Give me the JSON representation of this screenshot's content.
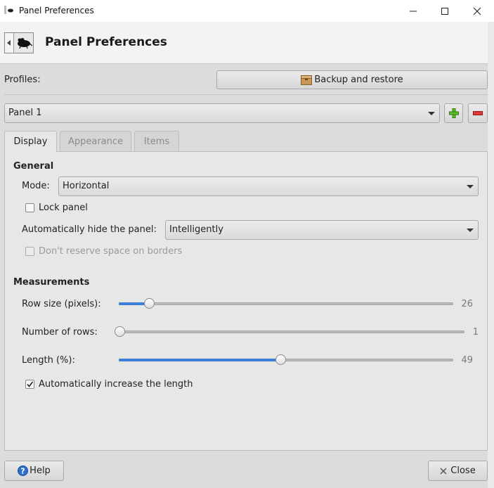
{
  "window": {
    "title": "Panel Preferences",
    "controls": {
      "minimize": "minimize-icon",
      "maximize": "maximize-icon",
      "close": "close-icon"
    }
  },
  "header": {
    "title": "Panel Preferences",
    "icon": "panel-mouse-icon"
  },
  "profiles": {
    "label": "Profiles:",
    "backup_button": "Backup and restore",
    "backup_icon": "package-icon",
    "selected_panel": "Panel 1",
    "add_icon": "plus-icon",
    "remove_icon": "minus-icon"
  },
  "tabs": [
    {
      "label": "Display",
      "active": true
    },
    {
      "label": "Appearance",
      "active": false
    },
    {
      "label": "Items",
      "active": false
    }
  ],
  "general": {
    "heading": "General",
    "mode_label": "Mode:",
    "mode_value": "Horizontal",
    "lock_label": "Lock panel",
    "lock_checked": false,
    "autohide_label": "Automatically hide the panel:",
    "autohide_value": "Intelligently",
    "reserve_label": "Don't reserve space on borders",
    "reserve_checked": false,
    "reserve_enabled": false
  },
  "measurements": {
    "heading": "Measurements",
    "row_size_label": "Row size (pixels):",
    "row_size_value": "26",
    "rows_label": "Number of rows:",
    "rows_value": "1",
    "length_label": "Length (%):",
    "length_value": "49",
    "auto_length_label": "Automatically increase the length",
    "auto_length_checked": true
  },
  "footer": {
    "help": "Help",
    "close": "Close",
    "help_icon": "question-icon",
    "close_icon": "x-icon"
  },
  "colors": {
    "accent": "#3a80d6",
    "add": "#4caf1f",
    "remove": "#d62828"
  }
}
